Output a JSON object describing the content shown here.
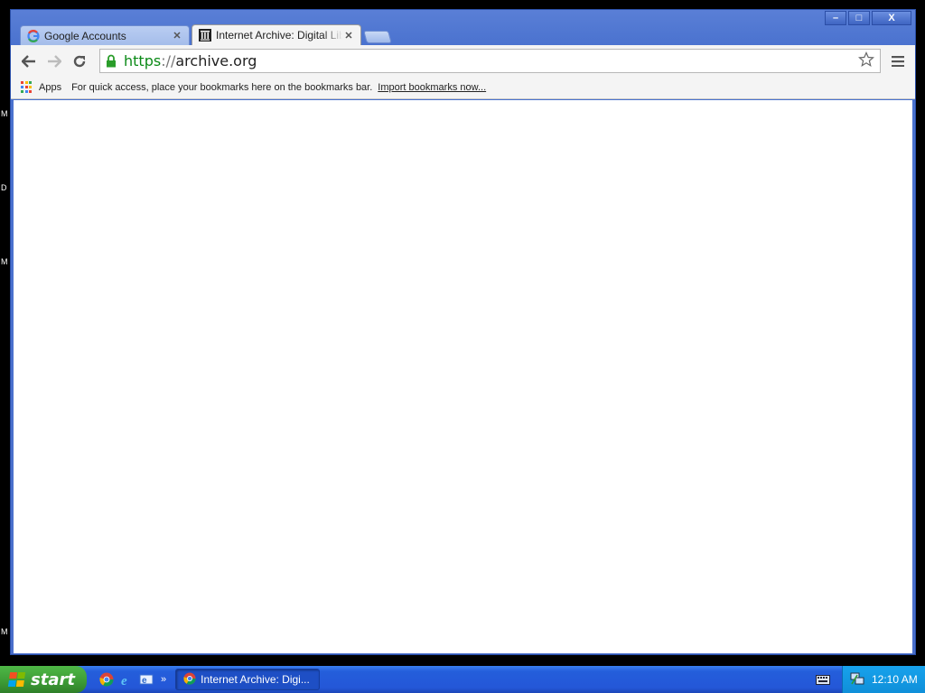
{
  "window": {
    "controls": {
      "minimize": "–",
      "maximize": "□",
      "close": "X"
    }
  },
  "tabs": [
    {
      "title": "Google Accounts",
      "favicon": "google-g-icon",
      "active": false
    },
    {
      "title": "Internet Archive: Digital Library",
      "favicon": "archive-columns-icon",
      "active": true
    }
  ],
  "toolbar": {
    "back": "back-arrow-icon",
    "forward": "forward-arrow-icon",
    "reload": "reload-icon",
    "url": {
      "scheme": "https",
      "separator": "://",
      "host": "archive.org"
    },
    "secure": true,
    "star": "star-icon",
    "menu": "hamburger-menu-icon"
  },
  "bookmarks_bar": {
    "apps_label": "Apps",
    "message": "For quick access, place your bookmarks here on the bookmarks bar.",
    "import_link": "Import bookmarks now..."
  },
  "desktop": {
    "side_letters": [
      "M",
      "D",
      "M",
      "M"
    ]
  },
  "taskbar": {
    "start_label": "start",
    "quick_launch": [
      "chrome-icon",
      "internet-explorer-icon",
      "outlook-express-icon"
    ],
    "chevron": "»",
    "task_item": "Internet Archive: Digi...",
    "clock": "12:10 AM"
  },
  "colors": {
    "title_bar": "#4a72cf",
    "url_scheme": "#0b8a17",
    "taskbar": "#245edb",
    "start_button": "#3c9a35",
    "tray": "#0f8fd9"
  }
}
